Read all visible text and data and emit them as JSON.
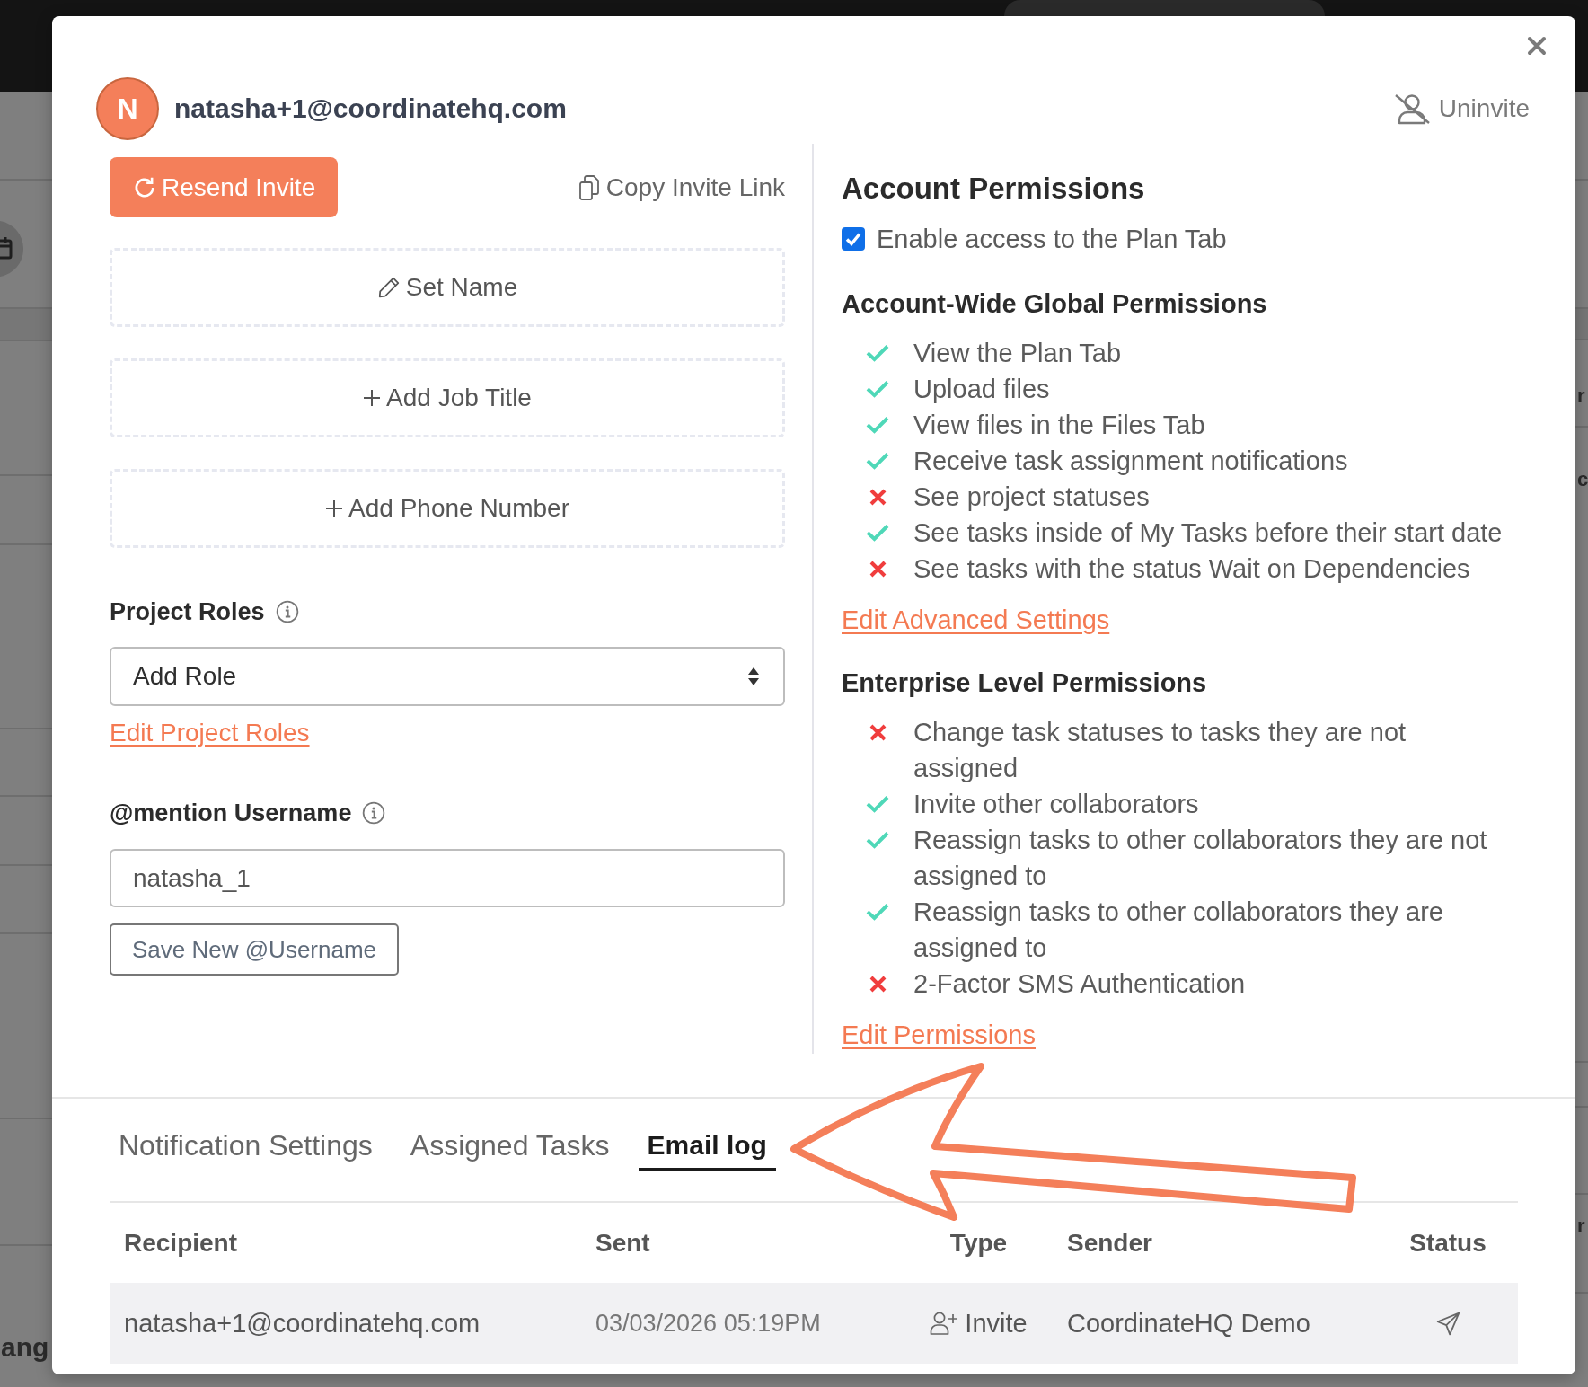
{
  "background_page": {
    "left_edge_text": "ang",
    "right_edge_texts": [
      "r",
      "c",
      "r"
    ]
  },
  "modal": {
    "avatar_letter": "N",
    "email": "natasha+1@coordinatehq.com",
    "uninvite": "Uninvite"
  },
  "invite_actions": {
    "resend": "Resend Invite",
    "copy_link": "Copy Invite Link"
  },
  "profile_fields": [
    {
      "kind": "edit",
      "label": "Set Name"
    },
    {
      "kind": "add",
      "label": "Add Job Title"
    },
    {
      "kind": "add",
      "label": "Add Phone Number"
    }
  ],
  "project_roles": {
    "label": "Project Roles",
    "select": {
      "value": "Add Role"
    },
    "link": "Edit Project Roles"
  },
  "mention_username": {
    "label": "@mention Username",
    "input": {
      "value": "natasha_1"
    },
    "save_button": "Save New @Username"
  },
  "account_permissions": {
    "title": "Account Permissions",
    "plan_tab_access": {
      "label": "Enable access to the Plan Tab",
      "checked": true
    },
    "sections": [
      {
        "title": "Account-Wide Global Permissions",
        "items": [
          {
            "label": "View the Plan Tab",
            "allowed": true
          },
          {
            "label": "Upload files",
            "allowed": true
          },
          {
            "label": "View files in the Files Tab",
            "allowed": true
          },
          {
            "label": "Receive task assignment notifications",
            "allowed": true
          },
          {
            "label": "See project statuses",
            "allowed": false
          },
          {
            "label": "See tasks inside of My Tasks before their start date",
            "allowed": true
          },
          {
            "label": "See tasks with the status Wait on Dependencies",
            "allowed": false
          }
        ],
        "link": "Edit Advanced Settings"
      },
      {
        "title": "Enterprise Level Permissions",
        "items": [
          {
            "label": "Change task statuses to tasks they are not assigned",
            "allowed": false
          },
          {
            "label": "Invite other collaborators",
            "allowed": true
          },
          {
            "label": "Reassign tasks to other collaborators they are not assigned to",
            "allowed": true
          },
          {
            "label": "Reassign tasks to other collaborators they are assigned to",
            "allowed": true
          },
          {
            "label": "2-Factor SMS Authentication",
            "allowed": false
          }
        ],
        "link": "Edit Permissions"
      }
    ]
  },
  "tabs": [
    {
      "label": "Notification Settings",
      "selected": false
    },
    {
      "label": "Assigned Tasks",
      "selected": false
    },
    {
      "label": "Email log",
      "selected": true
    }
  ],
  "email_log": {
    "columns": [
      "Recipient",
      "Sent",
      "Type",
      "Sender",
      "Status"
    ],
    "rows": [
      {
        "recipient": "natasha+1@coordinatehq.com",
        "sent": "03/03/2026 05:19PM",
        "type": {
          "kind": "invite",
          "label": "Invite"
        },
        "sender": "CoordinateHQ Demo",
        "status": {
          "kind": "sent"
        }
      }
    ]
  }
}
